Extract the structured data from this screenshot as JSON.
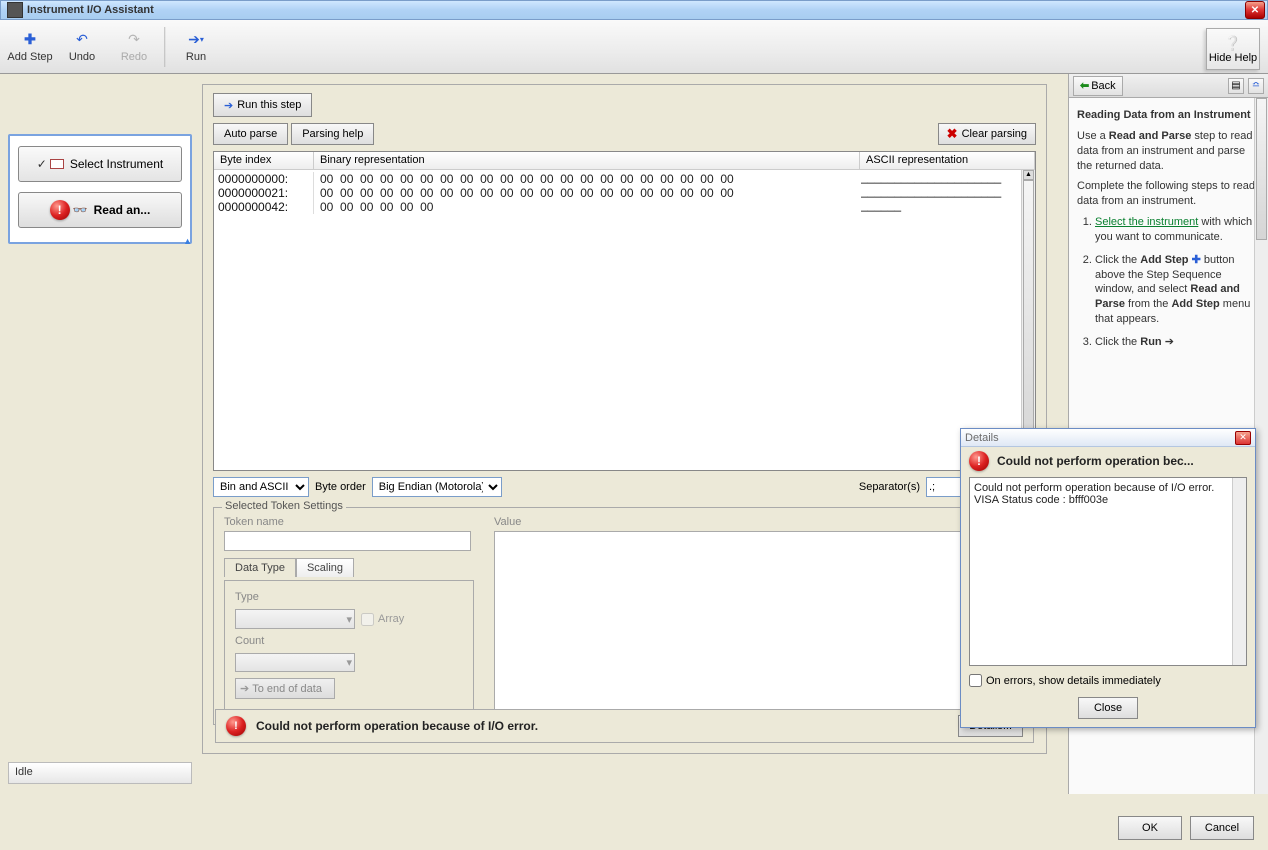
{
  "window": {
    "title": "Instrument I/O Assistant",
    "close_glyph": "✕"
  },
  "toolbar": {
    "add_step": "Add Step",
    "undo": "Undo",
    "redo": "Redo",
    "run": "Run",
    "hide_help": "Hide Help"
  },
  "steps": {
    "select": "Select Instrument",
    "read_parse": "Read an..."
  },
  "status": "Idle",
  "parser": {
    "run_this_step": "Run this step",
    "auto_parse": "Auto parse",
    "parsing_help": "Parsing help",
    "clear_parsing": "Clear parsing",
    "cols": {
      "byte_index": "Byte index",
      "binary": "Binary representation",
      "ascii": "ASCII representation"
    },
    "rows": [
      {
        "idx": "0000000000:",
        "bin": "00  00  00  00  00  00  00  00  00  00  00  00  00  00  00  00  00  00  00  00  00"
      },
      {
        "idx": "0000000021:",
        "bin": "00  00  00  00  00  00  00  00  00  00  00  00  00  00  00  00  00  00  00  00  00"
      },
      {
        "idx": "0000000042:",
        "bin": "00  00  00  00  00  00"
      }
    ],
    "ascii_rows": [
      "_____________________",
      "_____________________",
      "______"
    ]
  },
  "viewrow": {
    "mode": "Bin and ASCII",
    "byte_order_label": "Byte order",
    "byte_order": "Big Endian (Motorola)",
    "separator_label": "Separator(s)",
    "separator": ".;"
  },
  "token": {
    "legend": "Selected Token Settings",
    "token_name_lbl": "Token name",
    "value_lbl": "Value",
    "tab_datatype": "Data Type",
    "tab_scaling": "Scaling",
    "type_lbl": "Type",
    "array_lbl": "Array",
    "count_lbl": "Count",
    "to_end": "To end of data"
  },
  "error": {
    "msg": "Could not perform operation because of I/O error.",
    "details_btn": "Details..."
  },
  "help": {
    "back": "Back",
    "heading": "Reading Data from an Instrument",
    "intro_a": "Use a ",
    "intro_b": "Read and Parse",
    "intro_c": " step to read data from an instrument and parse the returned data.",
    "complete": "Complete the following steps to read data from an instrument.",
    "s1a": "Select the instrument",
    "s1b": " with which you want to communicate.",
    "s2a": "Click the ",
    "s2b": "Add Step",
    "s2c": " button above the Step Sequence window, and select ",
    "s2d": "Read and Parse",
    "s2e": " from the ",
    "s2f": "Add Step",
    "s2g": " menu that appears.",
    "s3a": "Click the ",
    "s3b": "Run"
  },
  "dialog": {
    "title": "Details",
    "heading": "Could not perform operation bec...",
    "body1": "Could not perform operation because of I/O error.",
    "body2": "VISA Status code : bfff003e",
    "check": "On errors, show details immediately",
    "close": "Close"
  },
  "footer": {
    "ok": "OK",
    "cancel": "Cancel"
  }
}
